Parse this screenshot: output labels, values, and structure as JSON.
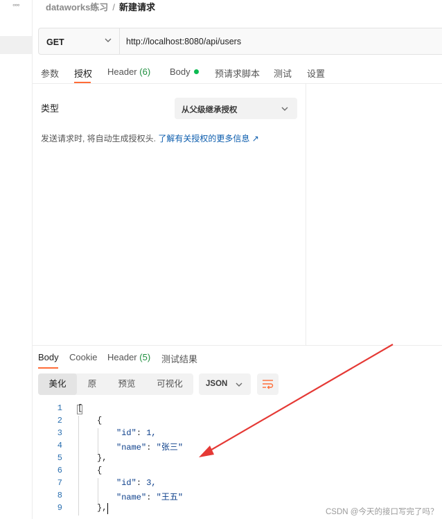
{
  "sidebar": {
    "more_label": "◦◦◦"
  },
  "breadcrumb": {
    "workspace": "dataworks练习",
    "separator": "/",
    "title": "新建请求"
  },
  "request": {
    "method": "GET",
    "url": "http://localhost:8080/api/users"
  },
  "request_tabs": {
    "params": "参数",
    "auth": "授权",
    "headers_label": "Header",
    "headers_count": "(6)",
    "body": "Body",
    "prerequest": "预请求脚本",
    "tests": "测试",
    "settings": "设置",
    "active": "授权"
  },
  "auth": {
    "type_label": "类型",
    "type_value": "从父级继承授权",
    "description": "发送请求时, 将自动生成授权头.",
    "link_text": "了解有关授权的更多信息 ↗"
  },
  "response_tabs": {
    "body": "Body",
    "cookie": "Cookie",
    "headers_label": "Header",
    "headers_count": "(5)",
    "test_results": "测试结果",
    "active": "Body"
  },
  "response_toolbar": {
    "views": [
      "美化",
      "原",
      "预览",
      "可视化"
    ],
    "active_view": "美化",
    "format": "JSON"
  },
  "response_body": {
    "line_numbers": [
      "1",
      "2",
      "3",
      "4",
      "5",
      "6",
      "7",
      "8",
      "9"
    ],
    "lines": [
      {
        "indent": 0,
        "text": "["
      },
      {
        "indent": 1,
        "text": "{"
      },
      {
        "indent": 2,
        "key": "\"id\"",
        "value": "1,",
        "value_type": "num"
      },
      {
        "indent": 2,
        "key": "\"name\"",
        "value": "\"张三\"",
        "value_type": "str"
      },
      {
        "indent": 1,
        "text": "},"
      },
      {
        "indent": 1,
        "text": "{"
      },
      {
        "indent": 2,
        "key": "\"id\"",
        "value": "3,",
        "value_type": "num"
      },
      {
        "indent": 2,
        "key": "\"name\"",
        "value": "\"王五\"",
        "value_type": "str"
      },
      {
        "indent": 1,
        "text": "},"
      }
    ]
  },
  "watermark": "CSDN @今天的接口写完了吗？",
  "colors": {
    "accent": "#ff6c37",
    "link": "#0b5cad",
    "annotation_arrow": "#e53935",
    "status_dot": "#0cbb52"
  }
}
